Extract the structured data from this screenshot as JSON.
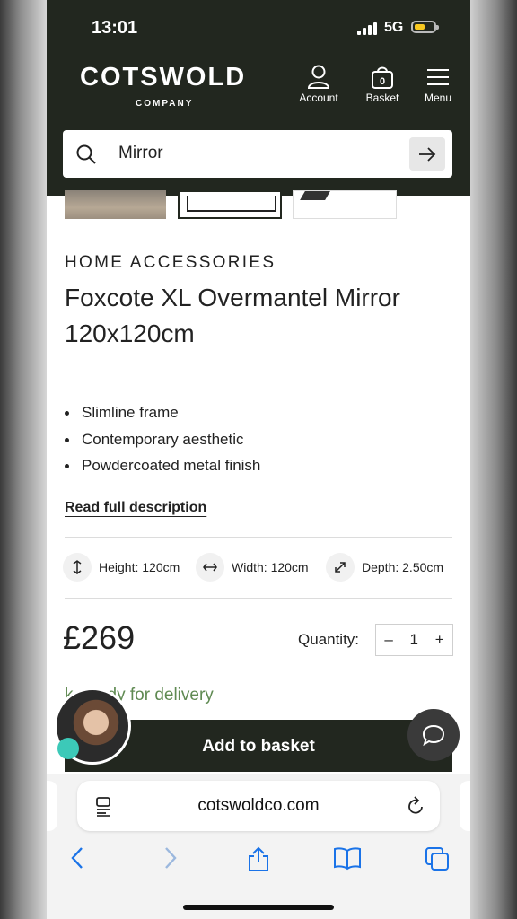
{
  "status": {
    "time": "13:01",
    "network": "5G"
  },
  "brand": {
    "name": "COTSWOLD",
    "sub": "COMPANY"
  },
  "header_nav": {
    "account": "Account",
    "basket": "Basket",
    "menu": "Menu",
    "basket_count": "0"
  },
  "search": {
    "value": "Mirror"
  },
  "product": {
    "category": "HOME ACCESSORIES",
    "title": "Foxcote XL Overmantel Mirror 120x120cm",
    "bullets": [
      "Slimline frame",
      "Contemporary aesthetic",
      "Powdercoated metal finish"
    ],
    "read_more": "Read full description",
    "dimensions": {
      "height": "Height: 120cm",
      "width": "Width: 120cm",
      "depth": "Depth: 2.50cm"
    },
    "price": "£269",
    "quantity_label": "Quantity:",
    "quantity": "1",
    "qty_minus": "–",
    "qty_plus": "+",
    "stock_visible": "k, ready for delivery",
    "add_to_basket": "Add to basket"
  },
  "browser": {
    "url": "cotswoldco.com"
  },
  "colors": {
    "header_bg": "#22271f",
    "stock_green": "#5f8a52",
    "chat_dot": "#3cc9b8",
    "ios_blue": "#1a73e8"
  }
}
